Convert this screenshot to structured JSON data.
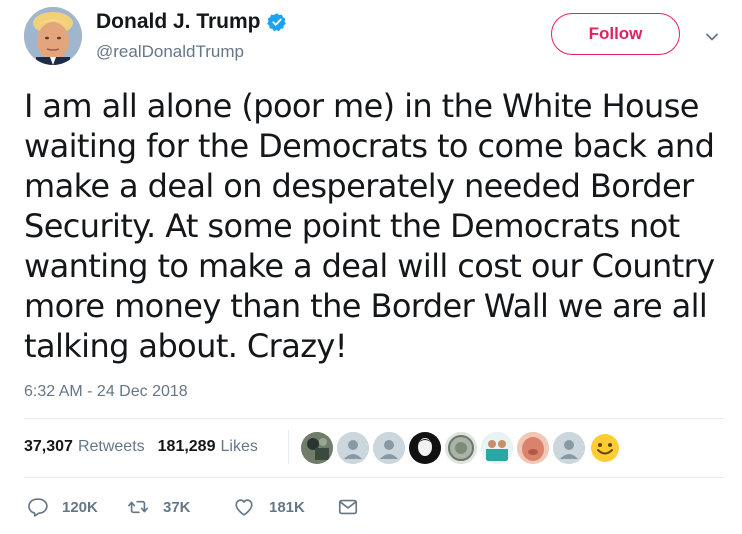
{
  "author": {
    "display_name": "Donald J. Trump",
    "handle": "@realDonaldTrump",
    "verified": true,
    "avatar_icon": "profile-photo"
  },
  "header": {
    "follow_label": "Follow",
    "menu_icon": "chevron-down-icon"
  },
  "tweet": {
    "text": "I am all alone (poor me) in the White House\nwaiting for the Democrats to come back and\nmake a deal on desperately needed Border\nSecurity. At some point the Democrats not\nwanting to make a deal will cost our Country\nmore money than the Border Wall we are all\ntalking about. Crazy!",
    "timestamp": "6:32 AM - 24 Dec 2018"
  },
  "stats": {
    "retweets_count": "37,307",
    "retweets_label": "Retweets",
    "likes_count": "181,289",
    "likes_label": "Likes"
  },
  "likers": [
    {
      "icon": "photo-avatar",
      "color": "#3b4a3f"
    },
    {
      "icon": "default-egg-avatar",
      "color": "#ccd6dd"
    },
    {
      "icon": "default-egg-avatar",
      "color": "#ccd6dd"
    },
    {
      "icon": "photo-avatar",
      "color": "#111111"
    },
    {
      "icon": "photo-avatar",
      "color": "#a9b3a6"
    },
    {
      "icon": "photo-avatar",
      "color": "#2aa6a3"
    },
    {
      "icon": "photo-avatar",
      "color": "#d9836c"
    },
    {
      "icon": "default-egg-avatar",
      "color": "#ccd6dd"
    },
    {
      "icon": "emoji-smiley-avatar",
      "color": "#ffcc33"
    }
  ],
  "actions": {
    "reply_count": "120K",
    "retweet_count": "37K",
    "like_count": "181K",
    "reply_icon": "reply-icon",
    "retweet_icon": "retweet-icon",
    "like_icon": "heart-icon",
    "dm_icon": "envelope-icon"
  },
  "colors": {
    "follow_accent": "#e0245e",
    "verified_blue": "#1da1f2",
    "secondary_text": "#657786",
    "primary_text": "#14171a",
    "divider": "#e6ecf0"
  }
}
